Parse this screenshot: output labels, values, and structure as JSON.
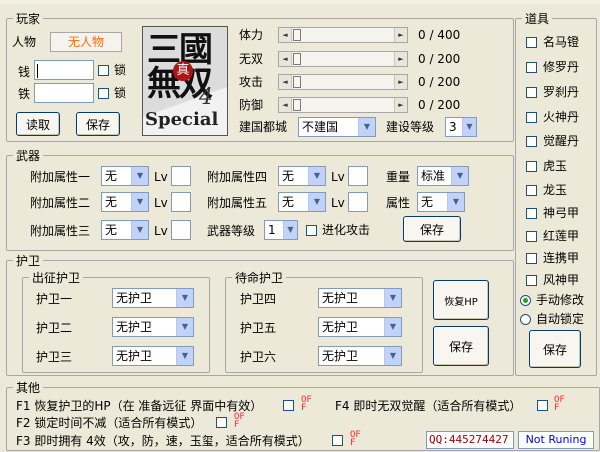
{
  "player": {
    "group": "玩家",
    "person_label": "人物",
    "person_value": "无人物",
    "money_label": "钱",
    "iron_label": "铁",
    "lock_label": "锁",
    "read_button": "读取",
    "save_button": "保存",
    "stats": [
      {
        "label": "体力",
        "current": 0,
        "max": 400,
        "text": "0 / 400"
      },
      {
        "label": "无双",
        "current": 0,
        "max": 200,
        "text": "0 / 200"
      },
      {
        "label": "攻击",
        "current": 0,
        "max": 200,
        "text": "0 / 200"
      },
      {
        "label": "防御",
        "current": 0,
        "max": 200,
        "text": "0 / 200"
      }
    ],
    "capital_label": "建国都城",
    "capital_value": "不建国",
    "build_level_label": "建设等级",
    "build_level_value": "3"
  },
  "logo": {
    "title_cn": "三國無双",
    "brand": "真",
    "number": "4",
    "subtitle": "Special"
  },
  "items": {
    "group": "道具",
    "list": [
      "名马镫",
      "修罗丹",
      "罗刹丹",
      "火神丹",
      "觉醒丹",
      "虎玉",
      "龙玉",
      "神弓甲",
      "红莲甲",
      "连携甲",
      "风神甲"
    ],
    "mode_manual": "手动修改",
    "mode_auto": "自动锁定",
    "save_button": "保存"
  },
  "weapon": {
    "group": "武器",
    "attr_labels": [
      "附加属性一",
      "附加属性二",
      "附加属性三",
      "附加属性四",
      "附加属性五"
    ],
    "attr_value": "无",
    "lv_label": "Lv",
    "weight_label": "重量",
    "weight_value": "标准",
    "element_label": "属性",
    "element_value": "无",
    "level_label": "武器等级",
    "level_value": "1",
    "evolve_label": "进化攻击",
    "save_button": "保存"
  },
  "guards": {
    "group": "护卫",
    "out_group": "出征护卫",
    "wait_group": "待命护卫",
    "out": [
      "护卫一",
      "护卫二",
      "护卫三"
    ],
    "wait": [
      "护卫四",
      "护卫五",
      "护卫六"
    ],
    "guard_value": "无护卫",
    "restore_button": "恢复HP",
    "save_button": "保存"
  },
  "other": {
    "group": "其他",
    "f1": "F1 恢复护卫的HP（在 准备远征 界面中有效）",
    "f2": "F2 锁定时间不减（适合所有模式）",
    "f3": "F3 即时拥有 4效（攻，防，速，玉玺，适合所有模式）",
    "f4": "F4 即时无双觉醒（适合所有模式）",
    "hotkey_top": "OF",
    "hotkey_bottom": "F",
    "qq": "QQ:445274427",
    "status": "Not Runing"
  }
}
